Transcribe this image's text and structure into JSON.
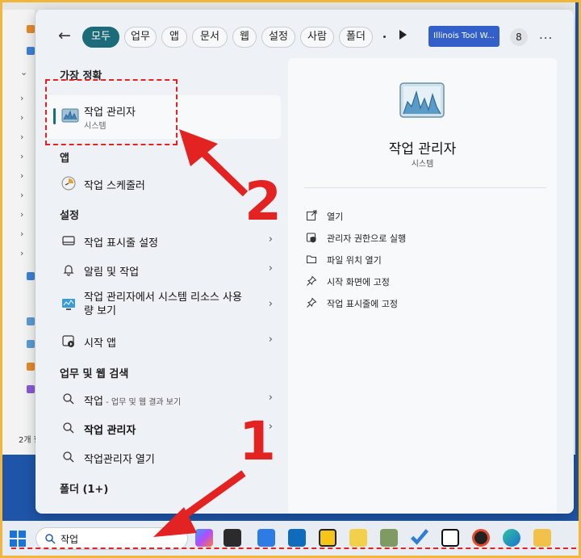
{
  "filters": {
    "back_icon": "back-arrow-icon",
    "chips": [
      "모두",
      "업무",
      "앱",
      "문서",
      "웹",
      "설정",
      "사람",
      "폴더"
    ],
    "organization": "Illinois Tool W...",
    "badge": "8",
    "more": "..."
  },
  "left": {
    "best_match": {
      "heading": "가장 정확",
      "title": "작업 관리자",
      "subtitle": "시스템"
    },
    "apps_heading": "앱",
    "apps": [
      {
        "label": "작업 스케줄러",
        "icon": "task-scheduler-icon"
      }
    ],
    "settings_heading": "설정",
    "settings": [
      {
        "label": "작업 표시줄 설정",
        "icon": "taskbar-settings-icon"
      },
      {
        "label": "알림 및 작업",
        "icon": "bell-icon"
      },
      {
        "label": "작업 관리자에서 시스템 리소스 사용량 보기",
        "icon": "monitor-icon"
      },
      {
        "label": "시작 앱",
        "icon": "startup-apps-icon"
      }
    ],
    "web_heading": "업무 및 웹 검색",
    "web": [
      {
        "label": "작업",
        "sub": " - 업무 및 웹 결과 보기",
        "icon": "search-icon"
      },
      {
        "label": "작업 관리자",
        "sub": "",
        "icon": "search-icon"
      },
      {
        "label": "작업관리자 열기",
        "sub": "",
        "icon": "search-icon"
      }
    ],
    "folders_heading": "폴더 (1+)"
  },
  "right": {
    "title": "작업 관리자",
    "subtitle": "시스템",
    "actions": [
      {
        "label": "열기",
        "icon": "open-icon"
      },
      {
        "label": "관리자 권한으로 실행",
        "icon": "admin-shield-icon"
      },
      {
        "label": "파일 위치 열기",
        "icon": "folder-icon"
      },
      {
        "label": "시작 화면에 고정",
        "icon": "pin-icon"
      },
      {
        "label": "작업 표시줄에 고정",
        "icon": "pin-icon"
      }
    ]
  },
  "explorer": {
    "item_count": "2개 항"
  },
  "taskbar": {
    "search_value": "작업",
    "apps": [
      "copilot-icon",
      "window-icon",
      "calendar-icon",
      "outlook-icon",
      "sticky-notes-icon",
      "snipping-tool-icon",
      "paint-icon",
      "todo-icon",
      "notion-icon",
      "app-icon",
      "edge-icon",
      "file-explorer-icon"
    ]
  },
  "annotations": {
    "step1": "1",
    "step2": "2"
  },
  "colors": {
    "accent": "#1c6b7a",
    "annotation": "#e32222",
    "org_badge": "#3360c8",
    "taskbar": "#e8ecf3"
  }
}
